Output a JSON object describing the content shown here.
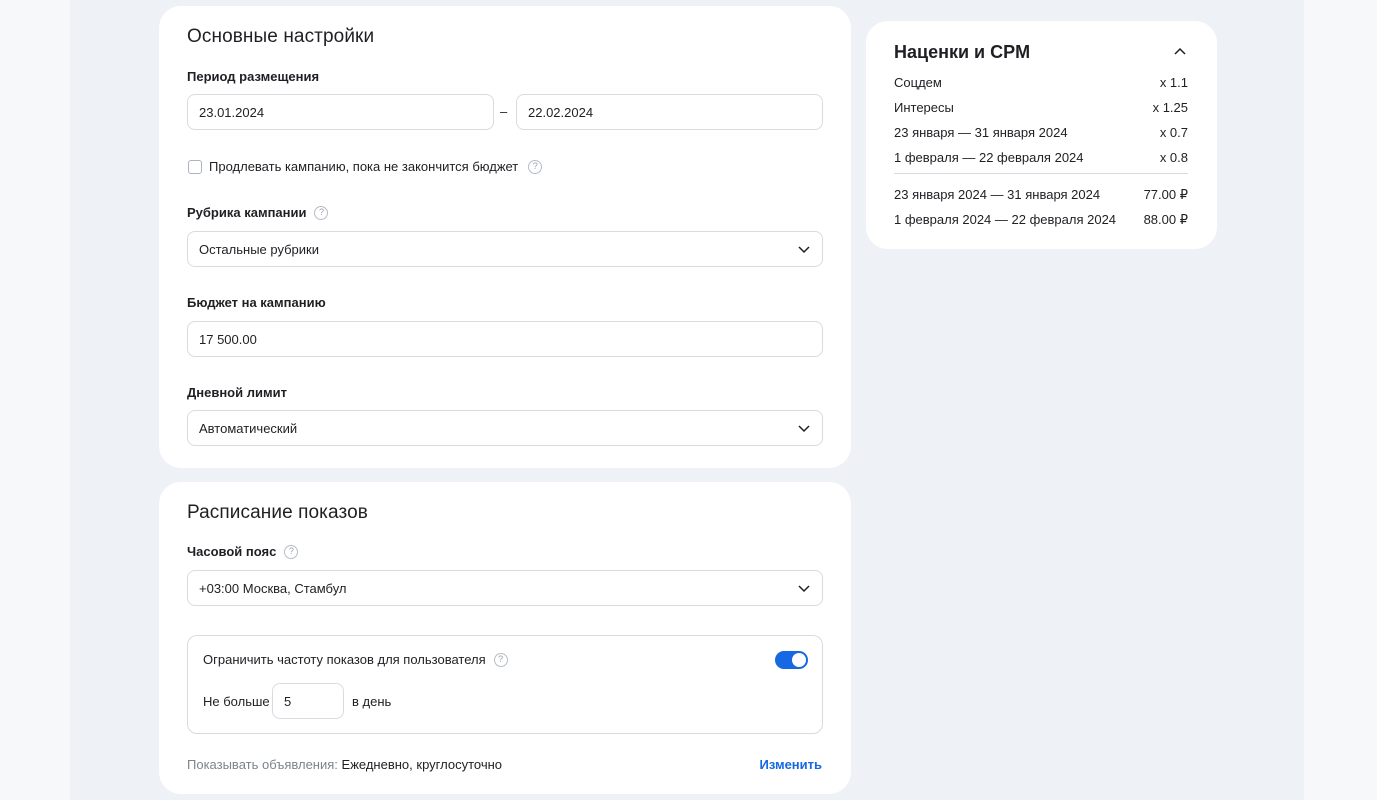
{
  "main_settings": {
    "title": "Основные настройки",
    "period_label": "Период размещения",
    "date_from": "23.01.2024",
    "date_separator": "–",
    "date_to": "22.02.2024",
    "extend_label": "Продлевать кампанию, пока не закончится бюджет",
    "extend_checked": false,
    "rubric_label": "Рубрика кампании",
    "rubric_value": "Остальные рубрики",
    "budget_label": "Бюджет на кампанию",
    "budget_value": "17 500.00",
    "daily_limit_label": "Дневной лимит",
    "daily_limit_value": "Автоматический"
  },
  "schedule": {
    "title": "Расписание показов",
    "timezone_label": "Часовой пояс",
    "timezone_value": "+03:00 Москва, Стамбул",
    "frequency_label": "Ограничить частоту показов для пользователя",
    "frequency_enabled": true,
    "max_prefix": "Не больше",
    "max_value": "5",
    "max_suffix": "в день",
    "show_ads_label": "Показывать объявления:",
    "show_ads_value": "Ежедневно, круглосуточно",
    "change_link": "Изменить"
  },
  "markups": {
    "title": "Наценки и CPM",
    "multipliers": [
      {
        "label": "Соцдем",
        "value": "x 1.1"
      },
      {
        "label": "Интересы",
        "value": "x 1.25"
      },
      {
        "label": "23 января — 31 января 2024",
        "value": "x 0.7"
      },
      {
        "label": "1 февраля — 22 февраля 2024",
        "value": "x 0.8"
      }
    ],
    "cpm": [
      {
        "label": "23 января 2024 — 31 января 2024",
        "value": "77.00 ₽"
      },
      {
        "label": "1 февраля 2024 — 22 февраля 2024",
        "value": "88.00 ₽"
      }
    ]
  },
  "help_icon_glyph": "?",
  "colors": {
    "accent": "#1668e3",
    "page_bg": "#eef1f6",
    "card_bg": "#ffffff",
    "border": "#d7dbe2",
    "muted_text": "#7d838d"
  },
  "icons": {
    "help": "question-circle-icon",
    "select": "chevron-down-icon",
    "collapse": "chevron-up-icon"
  }
}
